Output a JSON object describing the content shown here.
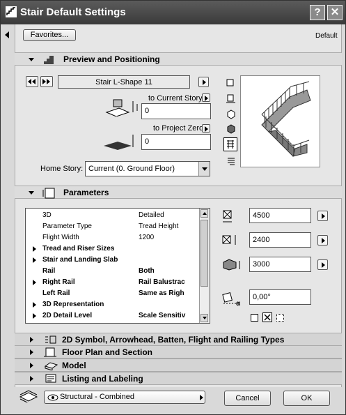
{
  "window": {
    "title": "Stair Default Settings",
    "help_btn": "?",
    "close_btn": "✕"
  },
  "top": {
    "favorites_label": "Favorites...",
    "default_label": "Default"
  },
  "preview": {
    "header": "Preview and Positioning",
    "stair_name": "Stair L-Shape 11",
    "to_current_story": "to Current Story",
    "current_story_value": "0",
    "to_project_zero": "to Project Zero",
    "project_zero_value": "0",
    "home_story_label": "Home Story:",
    "home_story_value": "Current (0. Ground Floor)"
  },
  "parameters": {
    "header": "Parameters",
    "rows": [
      {
        "name": "3D",
        "value": "Detailed",
        "bold": false,
        "expand": false
      },
      {
        "name": "Parameter Type",
        "value": "Tread Height",
        "bold": false,
        "expand": false
      },
      {
        "name": "Flight Width",
        "value": "1200",
        "bold": false,
        "expand": false
      },
      {
        "name": "Tread and Riser Sizes",
        "value": "",
        "bold": true,
        "expand": true
      },
      {
        "name": "Stair and Landing Slab",
        "value": "",
        "bold": true,
        "expand": true
      },
      {
        "name": "Rail",
        "value": "Both",
        "bold": true,
        "expand": false
      },
      {
        "name": "Right Rail",
        "value": "Rail Balustrac",
        "bold": true,
        "expand": true
      },
      {
        "name": "Left Rail",
        "value": "Same as Righ",
        "bold": true,
        "expand": false
      },
      {
        "name": "3D Representation",
        "value": "",
        "bold": true,
        "expand": true
      },
      {
        "name": "2D Detail Level",
        "value": "Scale Sensitiv",
        "bold": true,
        "expand": true
      }
    ],
    "width_value": "4500",
    "height_value": "2400",
    "elevation_value": "3000",
    "angle_value": "0,00°"
  },
  "collapsed_sections": [
    {
      "label": "2D Symbol, Arrowhead, Batten, Flight and Railing Types"
    },
    {
      "label": "Floor Plan and Section"
    },
    {
      "label": "Model"
    },
    {
      "label": "Listing and Labeling"
    }
  ],
  "footer": {
    "layer_value": "Structural - Combined",
    "cancel_label": "Cancel",
    "ok_label": "OK"
  }
}
